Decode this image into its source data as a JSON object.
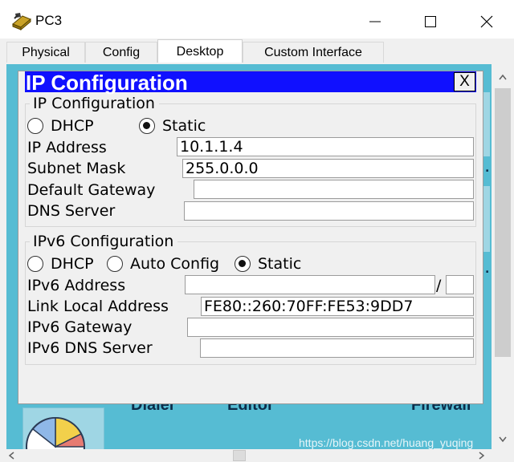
{
  "window": {
    "title": "PC3",
    "icon": "network-device-icon"
  },
  "tabs": [
    {
      "label": "Physical"
    },
    {
      "label": "Config"
    },
    {
      "label": "Desktop",
      "active": true
    },
    {
      "label": "Custom Interface"
    }
  ],
  "desktop": {
    "apps": [
      {
        "label": "Dialer",
        "icon": "dialer-icon"
      },
      {
        "label": "Editor",
        "icon": "editor-icon"
      },
      {
        "label": "Firewall",
        "icon": "firewall-icon"
      }
    ],
    "bg_color": "#56bcd3"
  },
  "dialog": {
    "title": "IP Configuration",
    "close_label": "X",
    "title_color": "#1010ff",
    "ipv4": {
      "legend": "IP Configuration",
      "dhcp_label": "DHCP",
      "static_label": "Static",
      "selected": "Static",
      "ip_label": "IP Address",
      "ip_value": "10.1.1.4",
      "mask_label": "Subnet Mask",
      "mask_value": "255.0.0.0",
      "gateway_label": "Default Gateway",
      "gateway_value": "",
      "dns_label": "DNS Server",
      "dns_value": ""
    },
    "ipv6": {
      "legend": "IPv6 Configuration",
      "dhcp_label": "DHCP",
      "auto_label": "Auto Config",
      "static_label": "Static",
      "selected": "Static",
      "address_label": "IPv6 Address",
      "address_value": "",
      "slash": "/",
      "prefix_value": "",
      "link_local_label": "Link Local Address",
      "link_local_value": "FE80::260:70FF:FE53:9DD7",
      "gateway_label": "IPv6 Gateway",
      "gateway_value": "",
      "dns_label": "IPv6 DNS Server",
      "dns_value": ""
    }
  },
  "watermark": "https://blog.csdn.net/huang_yuqing"
}
